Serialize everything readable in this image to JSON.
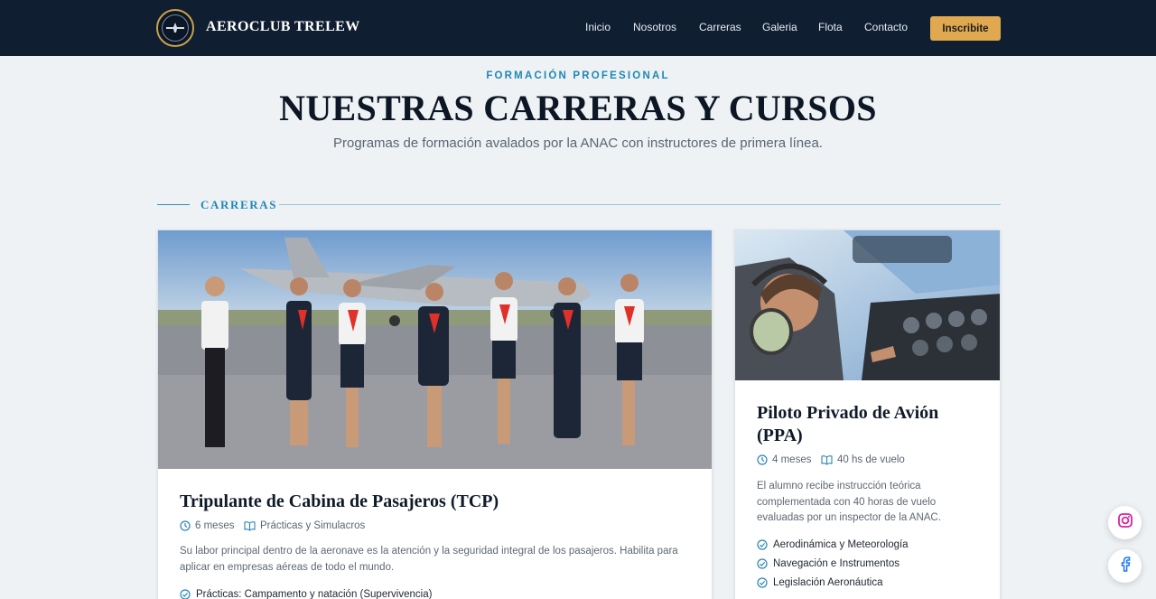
{
  "header": {
    "brand": "AEROCLUB TRELEW",
    "nav": [
      {
        "label": "Inicio"
      },
      {
        "label": "Nosotros"
      },
      {
        "label": "Carreras"
      },
      {
        "label": "Galeria"
      },
      {
        "label": "Flota"
      },
      {
        "label": "Contacto"
      }
    ],
    "cta_label": "Inscribite"
  },
  "hero": {
    "eyebrow": "FORMACIÓN PROFESIONAL",
    "title": "NUESTRAS CARRERAS Y CURSOS",
    "subtitle": "Programas de formación avalados por la ANAC con instructores de primera línea."
  },
  "section": {
    "label": "CARRERAS"
  },
  "courses": [
    {
      "title": "Tripulante de Cabina de Pasajeros (TCP)",
      "duration": "6 meses",
      "extra": "Prácticas y Simulacros",
      "description": "Su labor principal dentro de la aeronave es la atención y la seguridad integral de los pasajeros. Habilita para aplicar en empresas aéreas de todo el mundo.",
      "features": [
        "Prácticas: Campamento y natación (Supervivencia)"
      ]
    },
    {
      "title": "Piloto Privado de Avión (PPA)",
      "duration": "4 meses",
      "extra": "40 hs de vuelo",
      "description": "El alumno recibe instrucción teórica complementada con 40 horas de vuelo evaluadas por un inspector de la ANAC.",
      "features": [
        "Aerodinámica y Meteorología",
        "Navegación e Instrumentos",
        "Legislación Aeronáutica"
      ]
    }
  ],
  "colors": {
    "navbar": "#0f1e31",
    "accent": "#e0a94f",
    "link_blue": "#1f88b3",
    "page_bg": "#eef2f5"
  },
  "icons": {
    "clock": "clock-icon",
    "book": "book-icon",
    "check": "check-circle-icon",
    "instagram": "instagram-icon",
    "facebook": "facebook-icon"
  }
}
